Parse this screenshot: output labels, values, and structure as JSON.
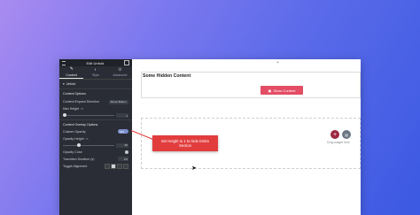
{
  "panel": {
    "title": "Edit Unfold",
    "tabs": [
      {
        "label": "Content",
        "icon": "pencil-icon",
        "active": true
      },
      {
        "label": "Style",
        "icon": "circle-half-icon",
        "active": false
      },
      {
        "label": "Advanced",
        "icon": "gear-icon",
        "active": false
      }
    ],
    "section_title": "Unfold",
    "subsection_title": "Content Options",
    "expand_label": "Content Expand Direction",
    "expand_value": "Above Button",
    "max_height_label": "Max Height",
    "max_height_value": "1",
    "overlay_title": "Content Overlay Options",
    "custom_opacity_label": "Custom Opacity",
    "custom_opacity_value": "YES",
    "opacity_height_label": "Opacity Height",
    "opacity_height_value": "50",
    "opacity_color_label": "Opacity Color",
    "transition_label": "Transition Duration (s)",
    "transition_value": "0.5",
    "toggle_align_label": "Toggle Alignment"
  },
  "canvas": {
    "top_plus": "+",
    "heading": "Some Hidden Content",
    "show_button": "Show Content",
    "add_icon": "+",
    "drag_text": "Drag widget here"
  },
  "callout": {
    "line1": "Set Height to 1 to Hide Entire",
    "line2": "Section"
  },
  "colors": {
    "accent": "#e34c63",
    "panel_bg": "#2a2d35",
    "callout": "#e23d3d"
  }
}
